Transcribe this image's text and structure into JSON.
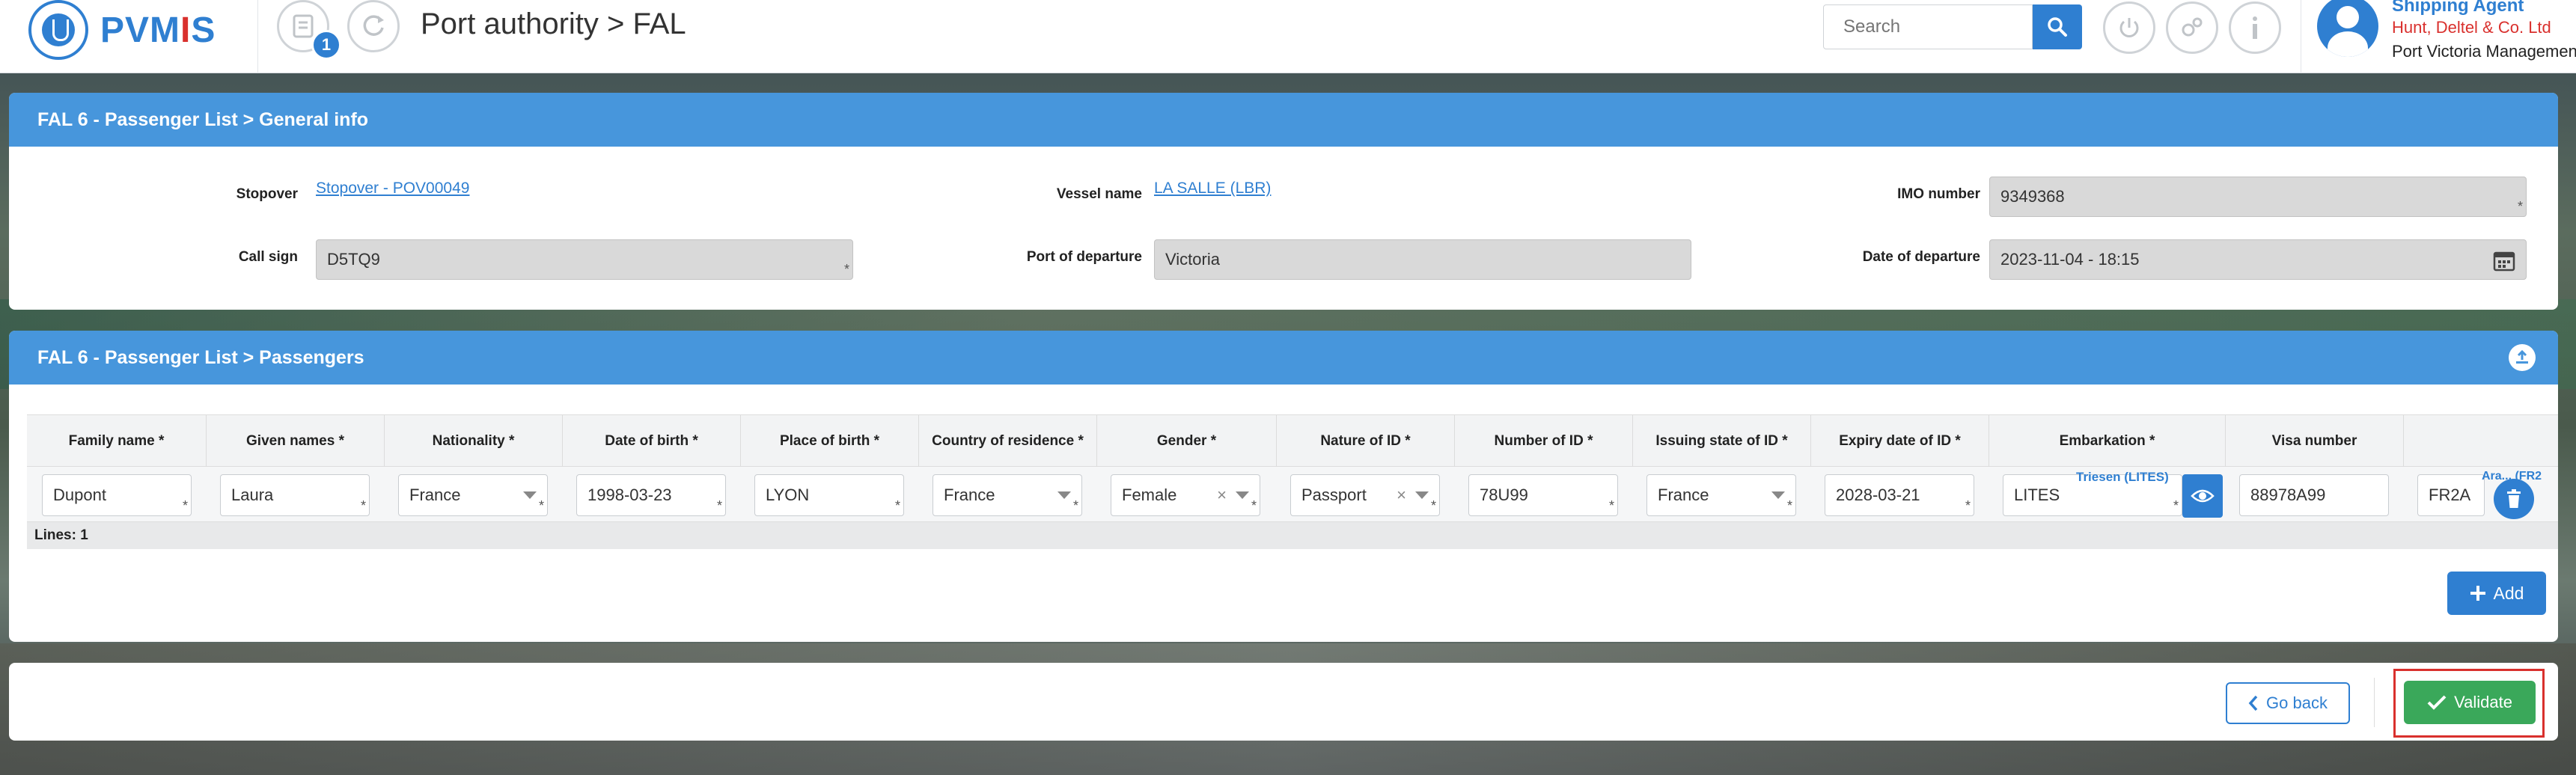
{
  "header": {
    "logo_main": "PVM",
    "logo_accent": "I",
    "logo_tail": "S",
    "notification_count": "1",
    "page_title": "Port authority > FAL",
    "search_placeholder": "Search",
    "user": {
      "role": "Shipping Agent",
      "company": "Hunt, Deltel & Co. Ltd",
      "organization": "Port Victoria Management"
    }
  },
  "general_info": {
    "panel_title": "FAL 6 - Passenger List > General info",
    "stopover_label": "Stopover",
    "stopover_value": "Stopover - POV00049",
    "vessel_label": "Vessel name",
    "vessel_value": "LA SALLE (LBR)",
    "imo_label": "IMO number",
    "imo_value": "9349368",
    "callsign_label": "Call sign",
    "callsign_value": "D5TQ9",
    "departure_port_label": "Port of departure",
    "departure_port_value": "Victoria",
    "departure_date_label": "Date of departure",
    "departure_date_value": "2023-11-04 - 18:15"
  },
  "passengers": {
    "panel_title": "FAL 6 - Passenger List > Passengers",
    "columns": [
      "Family name *",
      "Given names *",
      "Nationality *",
      "Date of birth *",
      "Place of birth *",
      "Country of residence *",
      "Gender *",
      "Nature of ID *",
      "Number of ID *",
      "Issuing state of ID *",
      "Expiry date of ID *",
      "Embarkation *",
      "Visa number"
    ],
    "row": {
      "family_name": "Dupont",
      "given_names": "Laura",
      "nationality": "France",
      "date_of_birth": "1998-03-23",
      "place_of_birth": "LYON",
      "country_of_residence": "France",
      "gender": "Female",
      "nature_of_id": "Passport",
      "number_of_id": "78U99",
      "issuing_state": "France",
      "expiry_date": "2028-03-21",
      "embarkation": "LITES",
      "embarkation_tag": "Triesen (LITES)",
      "visa_number": "88978A99",
      "disembarkation": "FR2A",
      "disembarkation_tag": "Ara... (FR2"
    },
    "lines_label": "Lines: 1",
    "add_label": "Add"
  },
  "footer": {
    "go_back_label": "Go back",
    "validate_label": "Validate"
  },
  "colors": {
    "primary": "#2f7fd1",
    "panel_header": "#4796dc",
    "validate": "#3aa85a",
    "highlight": "#d9302d"
  }
}
